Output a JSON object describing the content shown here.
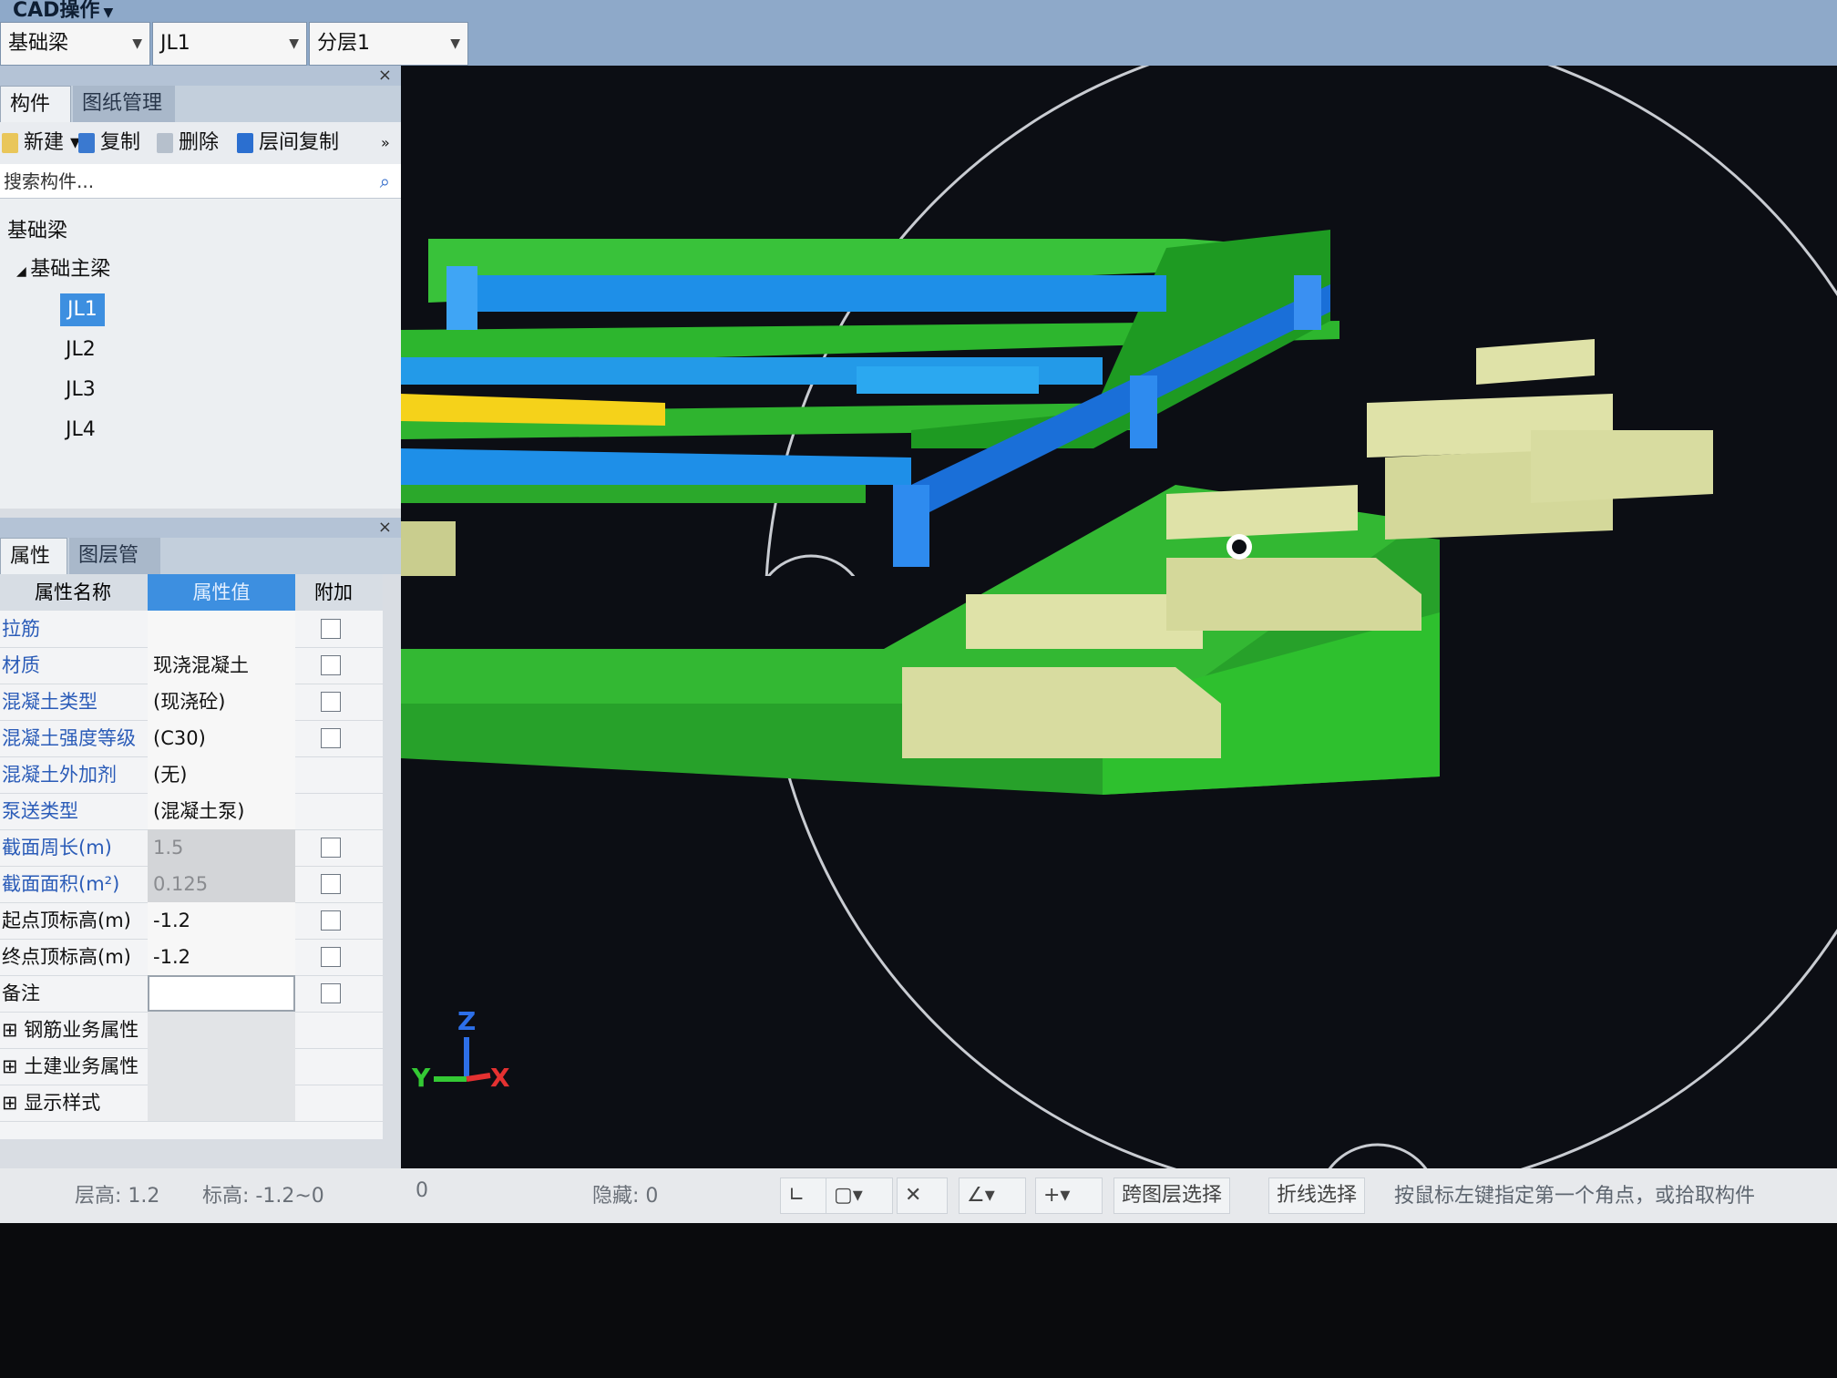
{
  "toolbar": {
    "cad_menu": "CAD操作",
    "combo_type": "基础梁",
    "combo_name": "JL1",
    "combo_layer": "分层1"
  },
  "component_panel": {
    "tab_list": "构件列表",
    "tab_drawing": "图纸管理",
    "btn_new": "新建",
    "btn_copy": "复制",
    "btn_delete": "删除",
    "btn_floor_copy": "层间复制",
    "search_placeholder": "搜索构件...",
    "tree_root": "基础梁",
    "tree_group": "基础主梁",
    "items": [
      "JL1",
      "JL2",
      "JL3",
      "JL4"
    ]
  },
  "property_panel": {
    "tab_props": "属性列表",
    "tab_layers": "图层管理",
    "col_name": "属性名称",
    "col_value": "属性值",
    "col_extra": "附加",
    "rows": [
      {
        "name": "拉筋",
        "value": ""
      },
      {
        "name": "材质",
        "value": "现浇混凝土"
      },
      {
        "name": "混凝土类型",
        "value": "(现浇砼)"
      },
      {
        "name": "混凝土强度等级",
        "value": "(C30)"
      },
      {
        "name": "混凝土外加剂",
        "value": "(无)"
      },
      {
        "name": "泵送类型",
        "value": "(混凝土泵)"
      },
      {
        "name": "截面周长(m)",
        "value": "1.5"
      },
      {
        "name": "截面面积(m²)",
        "value": "0.125"
      },
      {
        "name": "起点顶标高(m)",
        "value": "-1.2"
      },
      {
        "name": "终点顶标高(m)",
        "value": "-1.2"
      },
      {
        "name": "备注",
        "value": ""
      }
    ],
    "groups": [
      "钢筋业务属性",
      "土建业务属性",
      "显示样式"
    ]
  },
  "axis": {
    "z": "Z",
    "y": "Y",
    "x": "X"
  },
  "statusbar": {
    "floor_height_label": "层高:",
    "floor_height": "1.2",
    "elevation_label": "标高:",
    "elevation": "-1.2~0",
    "count": "0",
    "hidden_label": "隐藏:",
    "hidden": "0",
    "cross_layer": "跨图层选择",
    "polyline_select": "折线选择",
    "hint": "按鼠标左键指定第一个角点，或拾取构件"
  },
  "colors": {
    "beam_green": "#2fb42f",
    "beam_blue": "#1e8fe8",
    "footing": "#d8dca0",
    "highlight_yellow": "#f5d21a"
  }
}
